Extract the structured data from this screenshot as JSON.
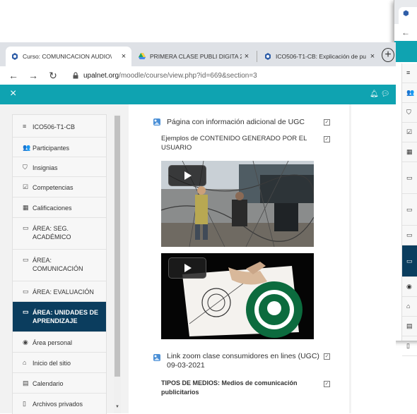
{
  "browser": {
    "tabs": [
      {
        "label": "Curso: COMUNICACION AUDIO\\",
        "close": "×",
        "active": true
      },
      {
        "label": "PRIMERA CLASE PUBLI DIGITA 2(",
        "close": "×",
        "active": false
      },
      {
        "label": "ICO506-T1-CB: Explicación de pu",
        "close": "×",
        "active": false
      }
    ],
    "new_tab": "+",
    "url_domain": "upalnet.org",
    "url_path": "/moodle/course/view.php?id=669&section=3"
  },
  "topbar": {
    "close": "×"
  },
  "sidebar": {
    "items": [
      {
        "icon": "≡",
        "label": "ICO506-T1-CB"
      },
      {
        "icon": "👥",
        "label": "Participantes"
      },
      {
        "icon": "⛉",
        "label": "Insignias"
      },
      {
        "icon": "☑",
        "label": "Competencias"
      },
      {
        "icon": "▦",
        "label": "Calificaciones"
      },
      {
        "icon": "▭",
        "label": "ÁREA: SEG. ACADÉMICO"
      },
      {
        "icon": "▭",
        "label": "ÁREA: COMUNICACIÓN"
      },
      {
        "icon": "▭",
        "label": "ÁREA: EVALUACIÓN"
      },
      {
        "icon": "▭",
        "label": "ÁREA: UNIDADES DE APRENDIZAJE"
      },
      {
        "icon": "◉",
        "label": "Área personal"
      },
      {
        "icon": "⌂",
        "label": "Inicio del sitio"
      },
      {
        "icon": "▤",
        "label": "Calendario"
      },
      {
        "icon": "▯",
        "label": "Archivos privados"
      }
    ]
  },
  "course": {
    "items": [
      {
        "title": "Página con información adicional de UGC"
      },
      {
        "title": "Ejemplos de CONTENIDO GENERADO POR EL USUARIO"
      },
      {
        "title": "Link zoom clase consumidores en lines (UGC) 09-03-2021"
      },
      {
        "title_bold": "TIPOS DE MEDIOS:",
        "title_rest": " Medios de comunicación publicitarios"
      }
    ]
  },
  "bg_window": {
    "sidebar_icons": [
      "≡",
      "👥",
      "⛉",
      "☑",
      "▦",
      "▭",
      "▭",
      "▭",
      "▭",
      "◉",
      "⌂",
      "▤",
      "▯"
    ]
  },
  "colors": {
    "accent": "#0fa3b1",
    "active_nav": "#0b3d5e"
  }
}
